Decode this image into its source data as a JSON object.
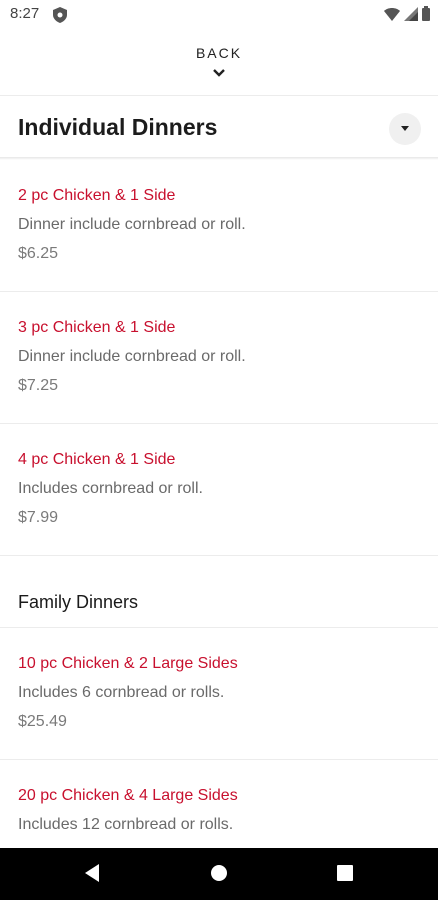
{
  "status_bar": {
    "time": "8:27"
  },
  "header": {
    "back_label": "BACK"
  },
  "category": {
    "title": "Individual Dinners"
  },
  "items": [
    {
      "name": "2 pc Chicken & 1 Side",
      "description": "Dinner include cornbread or roll.",
      "price": "$6.25"
    },
    {
      "name": "3 pc Chicken & 1 Side",
      "description": "Dinner include cornbread or roll.",
      "price": "$7.25"
    },
    {
      "name": "4 pc Chicken & 1 Side",
      "description": "Includes cornbread or roll.",
      "price": "$7.99"
    }
  ],
  "family_section": {
    "title": "Family Dinners",
    "items": [
      {
        "name": "10 pc Chicken & 2 Large Sides",
        "description": "Includes 6 cornbread or rolls.",
        "price": "$25.49"
      },
      {
        "name": "20 pc Chicken & 4 Large Sides",
        "description": "Includes 12 cornbread or rolls."
      }
    ]
  },
  "colors": {
    "accent": "#c8102e",
    "nav_bar": "#000000"
  }
}
